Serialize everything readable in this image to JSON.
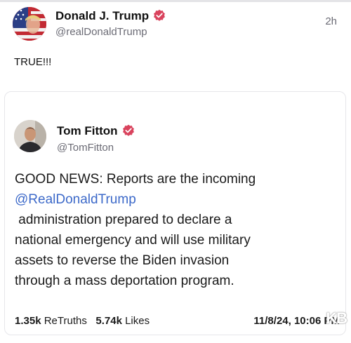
{
  "post": {
    "author_name": "Donald J. Trump",
    "handle": "@realDonaldTrump",
    "time": "2h",
    "text": "TRUE!!!",
    "avatar_icon": "flag-portrait-avatar"
  },
  "quote": {
    "author_name": "Tom Fitton",
    "handle": "@TomFitton",
    "avatar_icon": "portrait-avatar",
    "body_intro": "GOOD NEWS: Reports are the incoming",
    "mention": "@RealDonaldTrump",
    "body_lines": [
      " administration prepared to declare a",
      "national emergency and will use military",
      "assets to reverse the Biden invasion",
      "through a mass deportation program."
    ],
    "retruths_count": "1.35k",
    "retruths_label": "ReTruths",
    "likes_count": "5.74k",
    "likes_label": "Likes",
    "date": "11/8/24, 10:06 PM"
  },
  "watermark": "KB",
  "colors": {
    "verified_badge": "#d9435d",
    "mention": "#3c69c9",
    "secondary_text": "#6b6b75"
  }
}
